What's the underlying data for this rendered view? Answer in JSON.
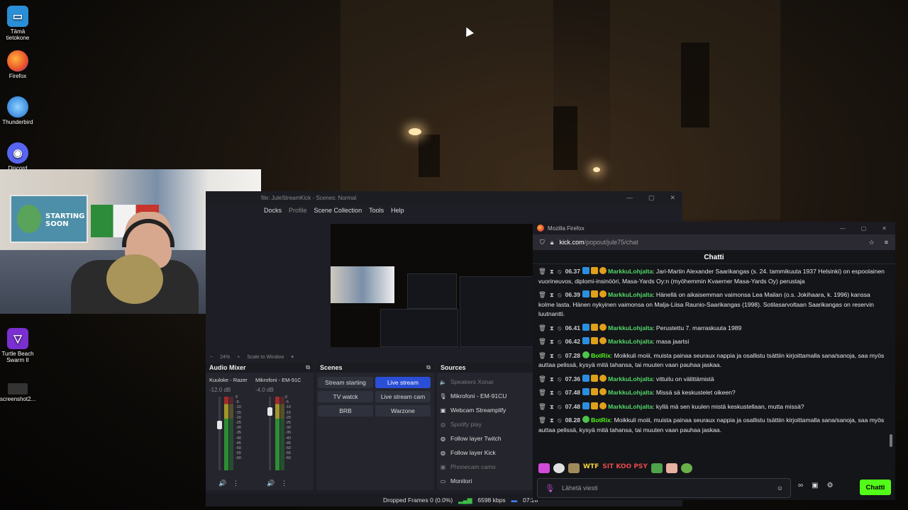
{
  "desktop": {
    "icons": [
      {
        "label": "Tämä tietokone",
        "icon": "monitor-icon"
      },
      {
        "label": "Firefox",
        "icon": "firefox-icon"
      },
      {
        "label": "Thunderbird",
        "icon": "thunderbird-icon"
      },
      {
        "label": "Discord",
        "icon": "discord-icon"
      },
      {
        "label": "Turtle Beach Swarm II",
        "icon": "turtle-beach-icon"
      },
      {
        "label": "screenshot2...",
        "icon": "image-file-icon"
      }
    ]
  },
  "webcam": {
    "poster_text": "STARTING SOON"
  },
  "obs": {
    "title": "file: JuleStreamKick - Scenes: Normal",
    "menu": [
      "Docks",
      "Profile",
      "Scene Collection",
      "Tools",
      "Help"
    ],
    "zoom": {
      "minus": "−",
      "value": "24%",
      "plus": "+",
      "mode": "Scale to Window"
    },
    "mixer": {
      "title": "Audio Mixer",
      "channels": [
        {
          "name": "Kuuloke - Razer",
          "db": "-12.0 dB",
          "level": 0.62
        },
        {
          "name": "Mikrofoni - EM-91C",
          "db": "-4.0 dB",
          "level": 0.8
        }
      ],
      "ticks": [
        "0",
        "-5",
        "-10",
        "-15",
        "-20",
        "-25",
        "-30",
        "-35",
        "-40",
        "-45",
        "-50",
        "-55",
        "-60"
      ]
    },
    "scenes": {
      "title": "Scenes",
      "items": [
        {
          "label": "Stream starting",
          "active": false
        },
        {
          "label": "Live stream",
          "active": true
        },
        {
          "label": "TV watck",
          "active": false
        },
        {
          "label": "Live stream cam",
          "active": false
        },
        {
          "label": "BRB",
          "active": false
        },
        {
          "label": "Warzone",
          "active": false
        }
      ]
    },
    "sources": {
      "title": "Sources",
      "items": [
        {
          "label": "Speakers Xonar",
          "enabled": false,
          "icon": "speaker-icon"
        },
        {
          "label": "Mikrofoni - EM-91CU",
          "enabled": true,
          "icon": "microphone-icon"
        },
        {
          "label": "Webcam Streamplify",
          "enabled": true,
          "icon": "camera-icon"
        },
        {
          "label": "Spotify play",
          "enabled": false,
          "icon": "globe-icon"
        },
        {
          "label": "Follow layer Twitch",
          "enabled": true,
          "icon": "globe-icon"
        },
        {
          "label": "Follow layer Kick",
          "enabled": true,
          "icon": "globe-icon"
        },
        {
          "label": "Phonecam camo",
          "enabled": false,
          "icon": "camera-icon"
        },
        {
          "label": "Monitori",
          "enabled": true,
          "icon": "monitor-icon"
        }
      ]
    },
    "status": {
      "dropped": "Dropped Frames 0 (0.0%)",
      "bitrate": "6598 kbps",
      "time": "07:28"
    }
  },
  "firefox": {
    "title": "Mozilla Firefox",
    "url_host": "kick.com",
    "url_path": "/popout/jule75/chat",
    "chat": {
      "header": "Chatti",
      "messages": [
        {
          "time": "06.37",
          "user": "MarkkuLohjalta",
          "bot": false,
          "text": "Jari-Martin Alexander Saarikangas (s. 24. tammikuuta 1937 Helsinki) on espoolainen vuorineuvos, diplomi-insinööri, Masa-Yards Oy:n (myöhemmin Kvaerner Masa-Yards Oy) perustaja"
        },
        {
          "time": "06.39",
          "user": "MarkkuLohjalta",
          "bot": false,
          "text": "Hänellä on aikaisemman vaimonsa Lea Mailan (o.s. Jokihaara, k. 1996) kanssa kolme lasta. Hänen nykyinen vaimonsa on Malja-Liisa Raunio-Saarikangas (1998). Sotilasarvoltaan Saarikangas on reservin luutnantti."
        },
        {
          "time": "06.41",
          "user": "MarkkuLohjalta",
          "bot": false,
          "text": "Perustettu 7. marraskuuta 1989"
        },
        {
          "time": "06.42",
          "user": "MarkkuLohjalta",
          "bot": false,
          "text": "masa jaartsi"
        },
        {
          "time": "07.28",
          "user": "BotRix",
          "bot": true,
          "text": "Moikkuli moiii, muista painaa seuraux nappia ja osallistu tsättiin kirjoittamalla sana/sanoja, saa myös auttaa pelissä, kysyä mitä tahansa, tai muuten vaan pauhaa jaskaa."
        },
        {
          "time": "07.36",
          "user": "MarkkuLohjalta",
          "bot": false,
          "text": "vittuilu on välittämistä"
        },
        {
          "time": "07.48",
          "user": "MarkkuLohjalta",
          "bot": false,
          "text": "Missä sä keskustelet oikeen?"
        },
        {
          "time": "07.48",
          "user": "MarkkuLohjalta",
          "bot": false,
          "text": "kyllä mä sen kuulen mistä keskustellaan, mutta missä?"
        },
        {
          "time": "08.28",
          "user": "BotRix",
          "bot": true,
          "text": "Moikkuli moiii, muista painaa seuraux nappia ja osallistu tsättiin kirjoittamalla sana/sanoja, saa myös auttaa pelissä, kysyä mitä tahansa, tai muuten vaan pauhaa jaskaa."
        }
      ],
      "emote_text": [
        "WTF",
        "SIT KOO PSY"
      ],
      "input_placeholder": "Lähetä viesti",
      "send_label": "Chatti"
    }
  }
}
